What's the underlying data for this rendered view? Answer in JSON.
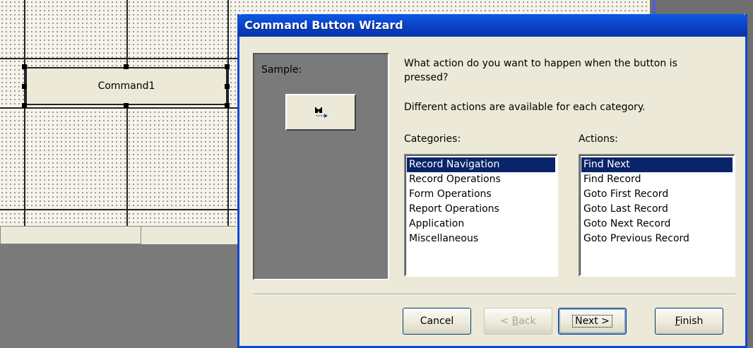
{
  "design_view": {
    "control_caption": "Command1"
  },
  "wizard": {
    "title": "Command Button Wizard",
    "sample_label": "Sample:",
    "question": "What action do you want to happen when the button is pressed?",
    "category_hint": "Different actions are available for each category.",
    "categories_label": "Categories:",
    "actions_label": "Actions:",
    "categories": [
      {
        "label": "Record Navigation",
        "selected": true
      },
      {
        "label": "Record Operations",
        "selected": false
      },
      {
        "label": "Form Operations",
        "selected": false
      },
      {
        "label": "Report Operations",
        "selected": false
      },
      {
        "label": "Application",
        "selected": false
      },
      {
        "label": "Miscellaneous",
        "selected": false
      }
    ],
    "actions": [
      {
        "label": "Find Next",
        "selected": true
      },
      {
        "label": "Find Record",
        "selected": false
      },
      {
        "label": "Goto First Record",
        "selected": false
      },
      {
        "label": "Goto Last Record",
        "selected": false
      },
      {
        "label": "Goto Next Record",
        "selected": false
      },
      {
        "label": "Goto Previous Record",
        "selected": false
      }
    ],
    "buttons": {
      "cancel": "Cancel",
      "back_prefix": "< ",
      "back_accel": "B",
      "back_rest": "ack",
      "next": "Next >",
      "finish_accel": "F",
      "finish_rest": "inish"
    },
    "sample_icon": "binoculars-arrow-icon"
  },
  "colors": {
    "title_bar": "#0a46d8",
    "selection": "#0a246a",
    "dialog_face": "#ece9d8"
  }
}
